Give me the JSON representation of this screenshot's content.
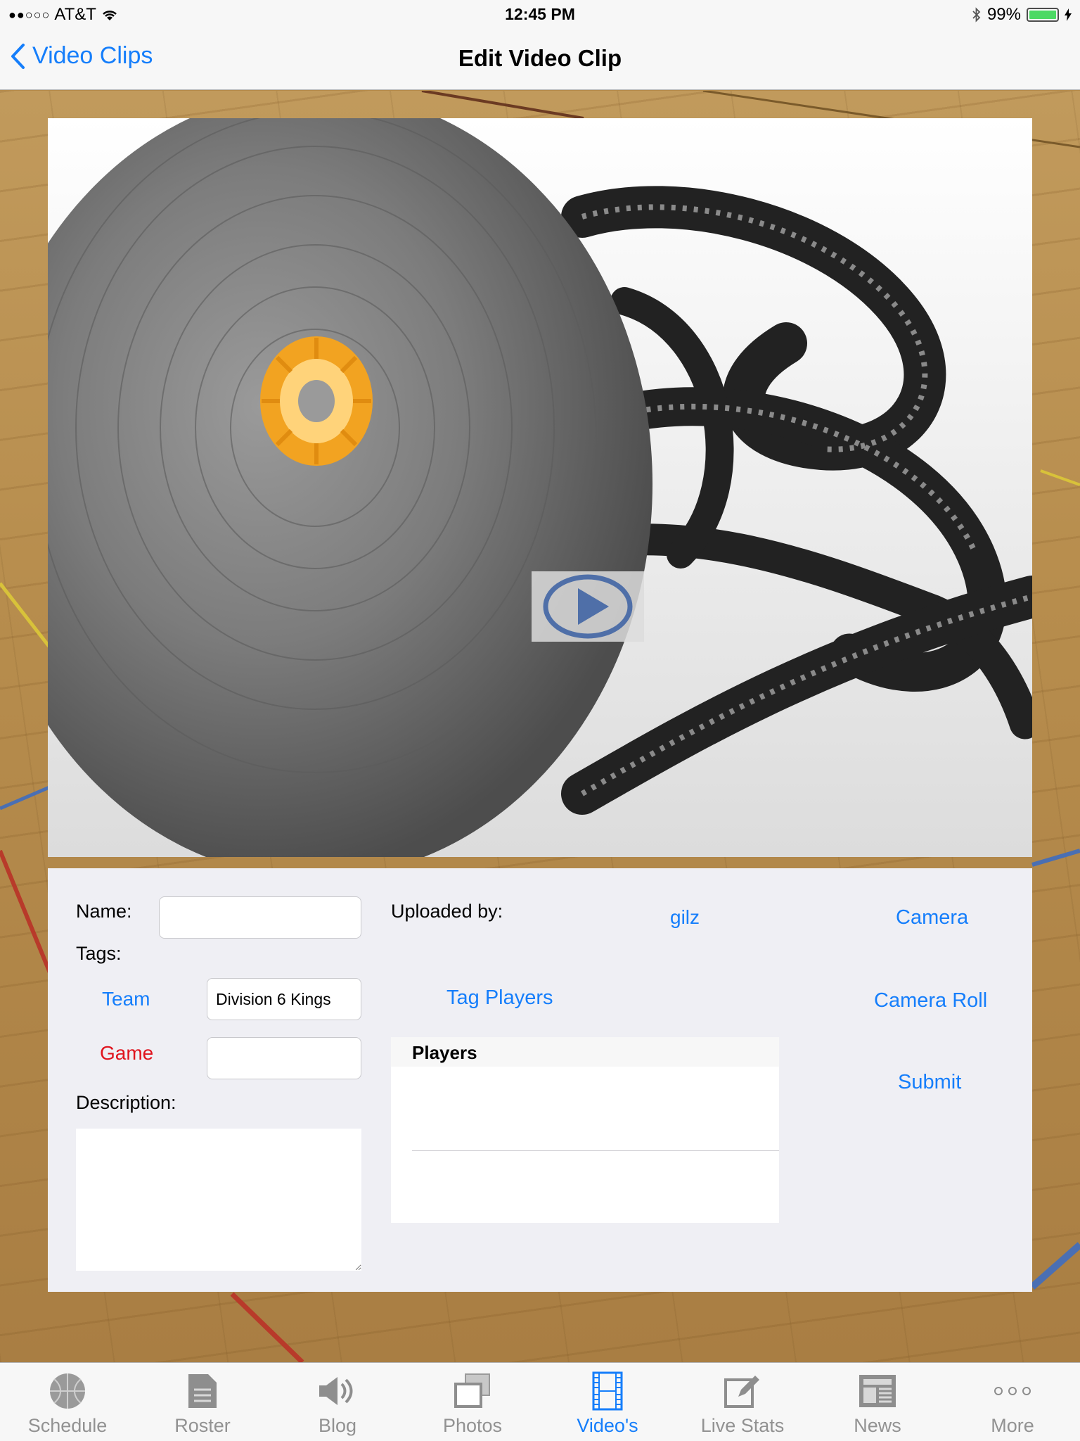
{
  "status_bar": {
    "signal_dots": "●●○○○",
    "carrier": "AT&T",
    "time": "12:45 PM",
    "battery_percent": "99%",
    "battery_level": 0.99
  },
  "nav": {
    "back_label": "Video Clips",
    "title": "Edit Video Clip"
  },
  "form": {
    "name_label": "Name:",
    "name_value": "",
    "tags_label": "Tags:",
    "team_label": "Team",
    "team_value": "Division 6 Kings",
    "game_label": "Game",
    "game_value": "",
    "description_label": "Description:",
    "description_value": "",
    "uploaded_by_label": "Uploaded by:",
    "uploaded_by_value": "gilz",
    "tag_players_label": "Tag Players",
    "players_header": "Players",
    "camera_label": "Camera",
    "camera_roll_label": "Camera Roll",
    "submit_label": "Submit"
  },
  "colors": {
    "accent": "#157efb",
    "game_label": "#e0141e",
    "panel_bg": "#efeff4"
  },
  "tabs": [
    {
      "label": "Schedule",
      "icon": "basketball-icon",
      "active": false
    },
    {
      "label": "Roster",
      "icon": "document-icon",
      "active": false
    },
    {
      "label": "Blog",
      "icon": "speaker-icon",
      "active": false
    },
    {
      "label": "Photos",
      "icon": "photos-icon",
      "active": false
    },
    {
      "label": "Video's",
      "icon": "film-icon",
      "active": true
    },
    {
      "label": "Live Stats",
      "icon": "edit-icon",
      "active": false
    },
    {
      "label": "News",
      "icon": "newspaper-icon",
      "active": false
    },
    {
      "label": "More",
      "icon": "more-icon",
      "active": false
    }
  ]
}
